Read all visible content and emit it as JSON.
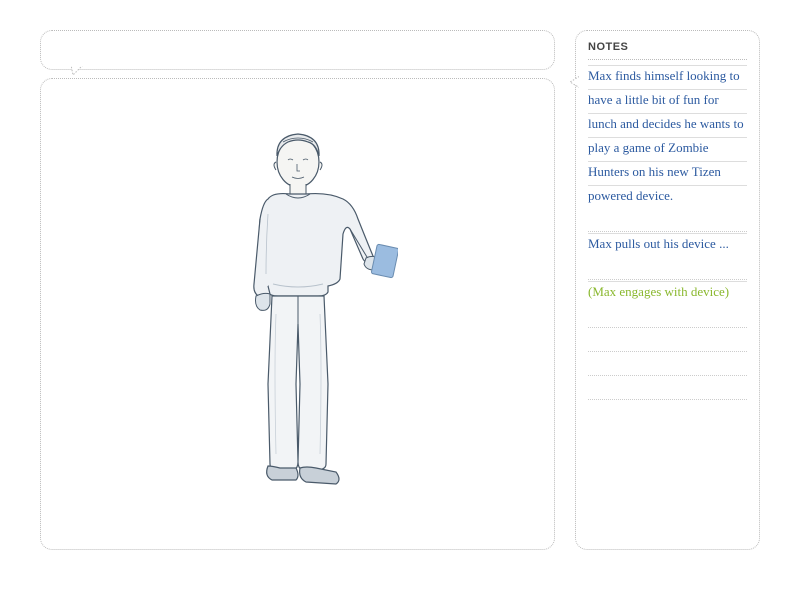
{
  "notes": {
    "header": "NOTES",
    "paragraph1": "Max finds himself looking to have a little bit of fun for lunch and decides he wants to play a game of Zombie Hunters on his new Tizen powered device.",
    "paragraph2": "Max pulls out his device ...",
    "paragraph3": "(Max engages with device)"
  },
  "colors": {
    "note_text": "#2c5aa0",
    "note_action": "#8ab82e",
    "border": "#bbbbbb"
  }
}
